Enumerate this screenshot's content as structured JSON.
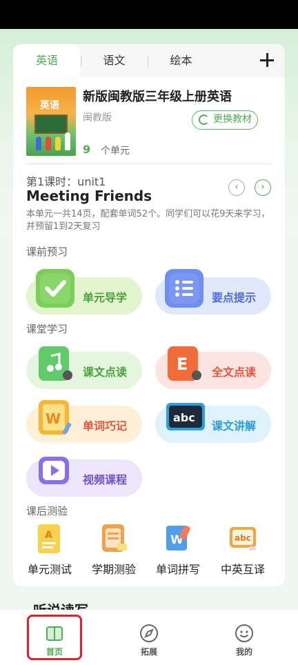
{
  "tabs": [
    {
      "label": "英语",
      "active": true
    },
    {
      "label": "语文",
      "active": false
    },
    {
      "label": "绘本",
      "active": false
    }
  ],
  "add_label": "+",
  "book": {
    "title": "新版闽教版三年级上册英语",
    "publisher": "闽教版",
    "change_label": "更换教材",
    "unit_count": "9",
    "unit_suffix": "个单元",
    "cover_title": "英语"
  },
  "lesson": {
    "number": "第1课时：unit1",
    "title": "Meeting Friends",
    "description": "本单元一共14页，配套单词52个。同学们可以花9天来学习，并预留1到2天复习"
  },
  "sections": {
    "pre": "课前预习",
    "class": "课堂学习",
    "post": "课后测验"
  },
  "pre_items": [
    {
      "label": "单元导学",
      "icon": "checkmark-book-icon"
    },
    {
      "label": "要点提示",
      "icon": "list-icon"
    }
  ],
  "class_items": [
    {
      "label": "课文点读",
      "icon": "music-note-pen-icon"
    },
    {
      "label": "全文点读",
      "icon": "letter-e-pen-icon"
    },
    {
      "label": "单词巧记",
      "icon": "letter-w-pencil-icon"
    },
    {
      "label": "课文讲解",
      "icon": "abc-blackboard-icon"
    },
    {
      "label": "视频课程",
      "icon": "video-play-icon"
    }
  ],
  "quiz_items": [
    {
      "label": "单元测试",
      "icon": "letter-a-paper-icon"
    },
    {
      "label": "学期测验",
      "icon": "notepad-icon"
    },
    {
      "label": "单词拼写",
      "icon": "letter-w-eraser-icon"
    },
    {
      "label": "中英互译",
      "icon": "abc-board-icon"
    }
  ],
  "peek": "听说读写",
  "bottom_nav": [
    {
      "label": "首页",
      "icon": "book-icon",
      "active": true
    },
    {
      "label": "拓展",
      "icon": "compass-icon",
      "active": false
    },
    {
      "label": "我的",
      "icon": "smiley-icon",
      "active": false
    }
  ],
  "colors": {
    "brand_green": "#4caf50",
    "highlight_red": "#e0202a"
  }
}
